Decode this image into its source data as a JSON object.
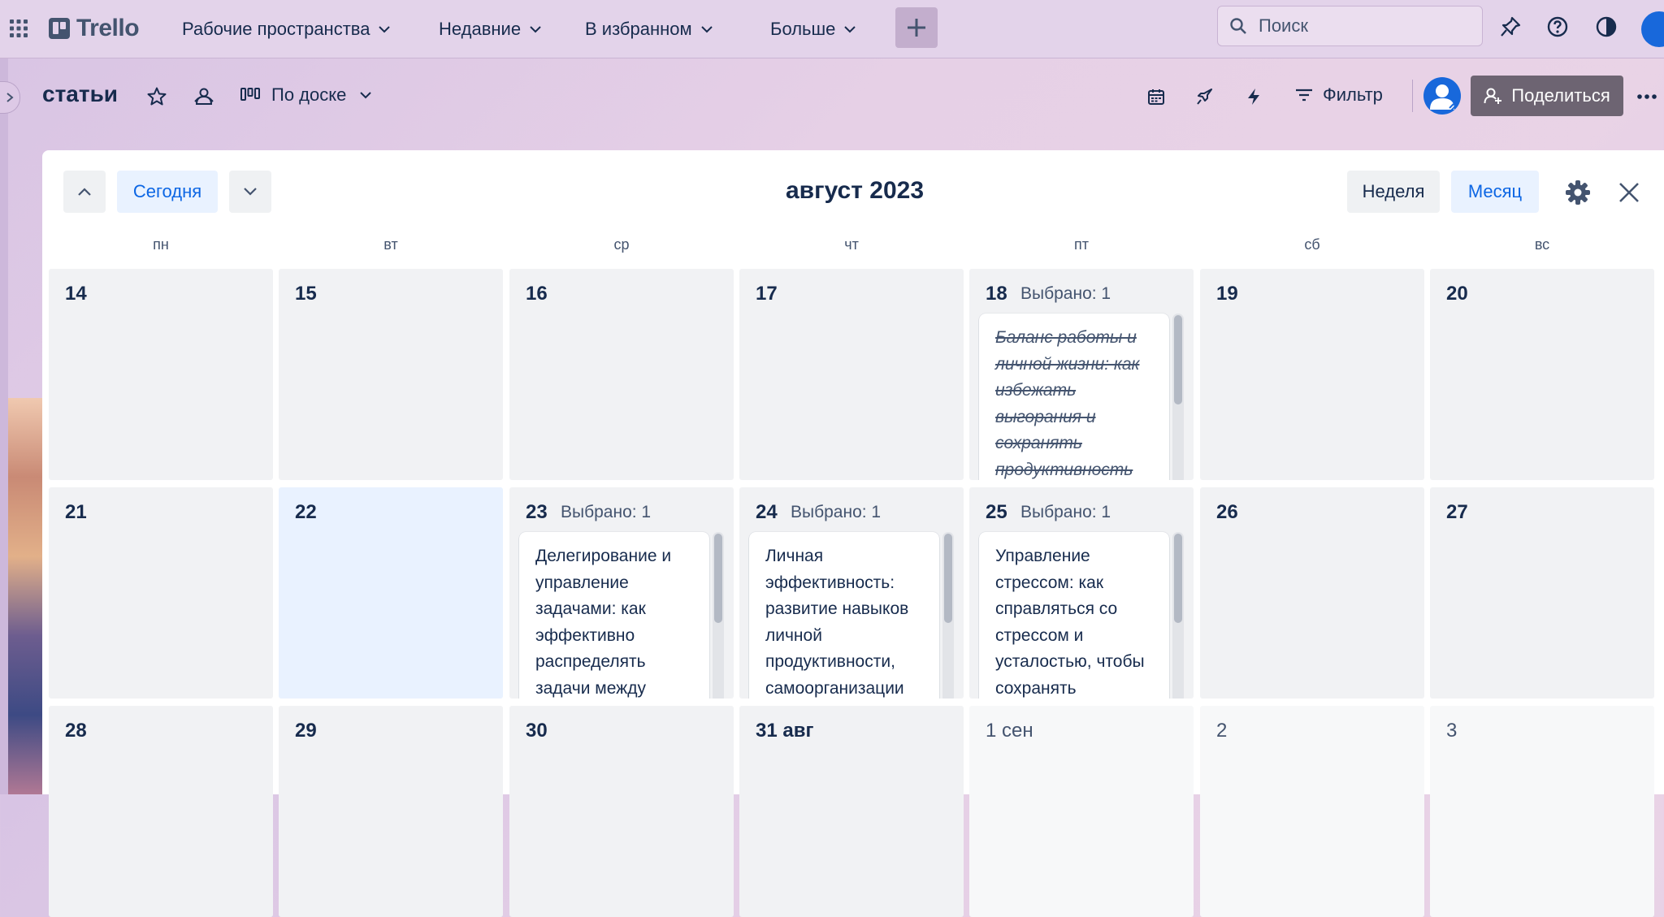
{
  "topnav": {
    "logo": "Trello",
    "menus": [
      {
        "label": "Рабочие пространства"
      },
      {
        "label": "Недавние"
      },
      {
        "label": "В избранном"
      },
      {
        "label": "Больше"
      }
    ],
    "search_placeholder": "Поиск"
  },
  "board": {
    "title": "статьи",
    "view_label": "По доске",
    "filter_label": "Фильтр",
    "share_label": "Поделиться"
  },
  "calendar": {
    "month_title": "август 2023",
    "today_label": "Сегодня",
    "week_label": "Неделя",
    "month_label": "Месяц",
    "selected_view": "Месяц",
    "weekdays": [
      "пн",
      "вт",
      "ср",
      "чт",
      "пт",
      "сб",
      "вс"
    ],
    "weeks": [
      [
        {
          "num": "14"
        },
        {
          "num": "15"
        },
        {
          "num": "16"
        },
        {
          "num": "17"
        },
        {
          "num": "18",
          "selected": "Выбрано: 1",
          "card": "Баланс работы и личной жизни: как избежать выгорания и сохранять продуктивность",
          "done": true
        },
        {
          "num": "19"
        },
        {
          "num": "20"
        }
      ],
      [
        {
          "num": "21"
        },
        {
          "num": "22",
          "today": true
        },
        {
          "num": "23",
          "selected": "Выбрано: 1",
          "card": "Делегирование и управление задачами: как эффективно распределять задачи между"
        },
        {
          "num": "24",
          "selected": "Выбрано: 1",
          "card": "Личная эффективность: развитие навыков личной продуктивности, самоорганизации"
        },
        {
          "num": "25",
          "selected": "Выбрано: 1",
          "card": "Управление стрессом: как справляться со стрессом и усталостью, чтобы сохранять"
        },
        {
          "num": "26"
        },
        {
          "num": "27"
        }
      ],
      [
        {
          "num": "28"
        },
        {
          "num": "29"
        },
        {
          "num": "30"
        },
        {
          "num": "31 авг"
        },
        {
          "num": "1 сен",
          "other": true
        },
        {
          "num": "2",
          "other": true
        },
        {
          "num": "3",
          "other": true
        }
      ]
    ]
  },
  "colors": {
    "accent": "#0c66e4",
    "brand": "#44546f",
    "share_button": "#6d6472"
  }
}
